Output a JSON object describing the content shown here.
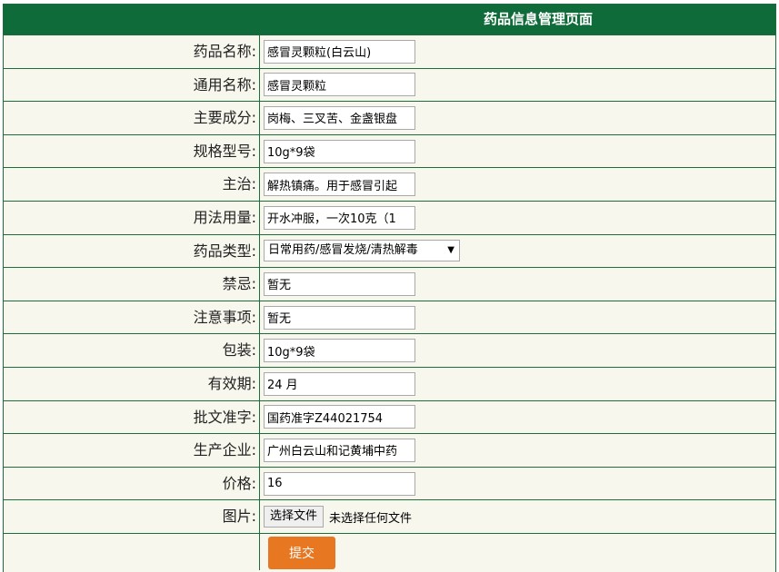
{
  "header": {
    "title": "药品信息管理页面"
  },
  "fields": [
    {
      "label": "药品名称:",
      "value": "感冒灵颗粒(白云山)"
    },
    {
      "label": "通用名称:",
      "value": "感冒灵颗粒"
    },
    {
      "label": "主要成分:",
      "value": "岗梅、三叉苦、金盏银盘"
    },
    {
      "label": "规格型号:",
      "value": "10g*9袋"
    },
    {
      "label": "主治:",
      "value": "解热镇痛。用于感冒引起"
    },
    {
      "label": "用法用量:",
      "value": "开水冲服，一次10克（1"
    },
    {
      "label": "药品类型:",
      "value": "日常用药/感冒发烧/清热解毒"
    },
    {
      "label": "禁忌:",
      "value": "暂无"
    },
    {
      "label": "注意事项:",
      "value": "暂无"
    },
    {
      "label": "包装:",
      "value": "10g*9袋"
    },
    {
      "label": "有效期:",
      "value": "24 月"
    },
    {
      "label": "批文准字:",
      "value": "国药准字Z44021754"
    },
    {
      "label": "生产企业:",
      "value": "广州白云山和记黄埔中药"
    },
    {
      "label": "价格:",
      "value": "16"
    },
    {
      "label": "图片:",
      "button": "选择文件",
      "status": "未选择任何文件"
    }
  ],
  "submit_label": "提交",
  "colors": {
    "header_bg": "#0f6b39",
    "row_bg": "#f7f7ed",
    "submit_bg": "#e87722"
  }
}
